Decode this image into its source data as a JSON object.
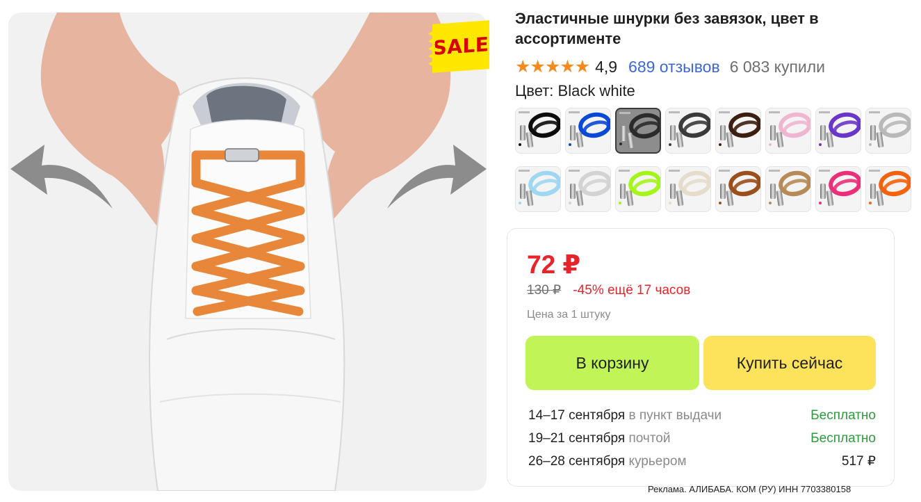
{
  "product": {
    "title": "Эластичные шнурки без завязок, цвет в ассортименте",
    "badge": "SALE",
    "rating": {
      "stars": "★★★★★",
      "value": "4,9",
      "reviews": "689 отзывов",
      "bought": "6 083 купили"
    },
    "color": {
      "label": "Цвет: Black white",
      "options": [
        {
          "name": "Black",
          "hex": "#0d0d0d",
          "selected": false
        },
        {
          "name": "Royal blue",
          "hex": "#0a49d6",
          "selected": false
        },
        {
          "name": "Black white",
          "hex": "#2b2b2b",
          "selected": true
        },
        {
          "name": "Dark grey",
          "hex": "#3b3b3b",
          "selected": false
        },
        {
          "name": "Coffee",
          "hex": "#3d1f12",
          "selected": false
        },
        {
          "name": "Pink",
          "hex": "#f0b6d0",
          "selected": false
        },
        {
          "name": "Purple",
          "hex": "#6a35c9",
          "selected": false
        },
        {
          "name": "Light grey",
          "hex": "#b9b9b9",
          "selected": false
        },
        {
          "name": "Sky blue",
          "hex": "#9fd6f1",
          "selected": false
        },
        {
          "name": "Silver",
          "hex": "#d3d3d3",
          "selected": false
        },
        {
          "name": "Fluorescent green",
          "hex": "#a6f51a",
          "selected": false
        },
        {
          "name": "Beige",
          "hex": "#e6dccb",
          "selected": false
        },
        {
          "name": "Brown",
          "hex": "#9b4f1c",
          "selected": false
        },
        {
          "name": "Khaki",
          "hex": "#b78b57",
          "selected": false
        },
        {
          "name": "Rose red",
          "hex": "#ec2f79",
          "selected": false
        },
        {
          "name": "Orange",
          "hex": "#f5620c",
          "selected": false
        }
      ]
    }
  },
  "offer": {
    "price": "72 ₽",
    "old_price": "130 ₽",
    "discount": "-45% ещё 17 часов",
    "unit_note": "Цена за 1 штуку",
    "cart_button": "В корзину",
    "buy_button": "Купить сейчас",
    "delivery": [
      {
        "dates": "14–17 сентября",
        "method": "в пункт выдачи",
        "price": "Бесплатно",
        "free": true
      },
      {
        "dates": "19–21 сентября",
        "method": "почтой",
        "price": "Бесплатно",
        "free": true
      },
      {
        "dates": "26–28 сентября",
        "method": "курьером",
        "price": "517 ₽",
        "free": false
      }
    ]
  },
  "ad_note": "Реклама. АЛИБАБА. КОМ (РУ) ИНН 7703380158",
  "colors": {
    "price_red": "#e8242b",
    "star_orange": "#f78a1d",
    "link_blue": "#3e66d8",
    "cart_green": "#c1f557",
    "buy_yellow": "#fde35b",
    "free_green": "#2c9b3c",
    "lace_orange": "#e8873a"
  }
}
